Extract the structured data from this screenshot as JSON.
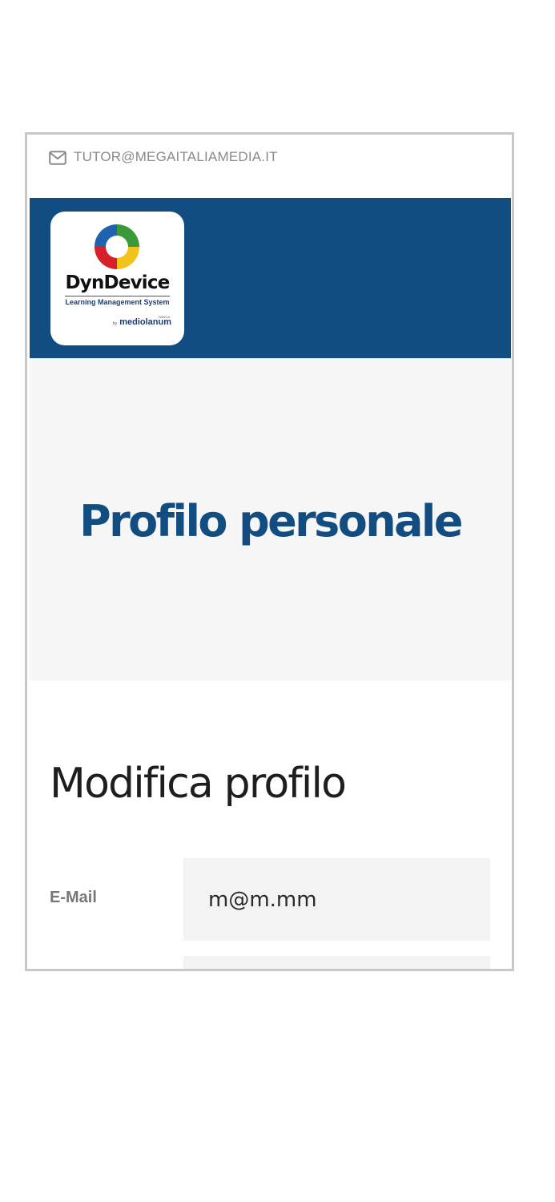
{
  "topbar": {
    "email": "TUTOR@MEGAITALIAMEDIA.IT",
    "icon": "envelope-icon"
  },
  "logo": {
    "brand": "DynDevice",
    "tagline": "Learning Management System",
    "by": "by",
    "partner": "mediolanum",
    "partner_prefix": "BANCA"
  },
  "hero": {
    "title": "Profilo personale"
  },
  "form": {
    "section_title": "Modifica profilo",
    "email_label": "E-Mail",
    "email_value": "m@m.mm"
  },
  "colors": {
    "brand_blue": "#124d82",
    "hero_bg": "#f6f6f6",
    "input_bg": "#f3f3f3"
  }
}
